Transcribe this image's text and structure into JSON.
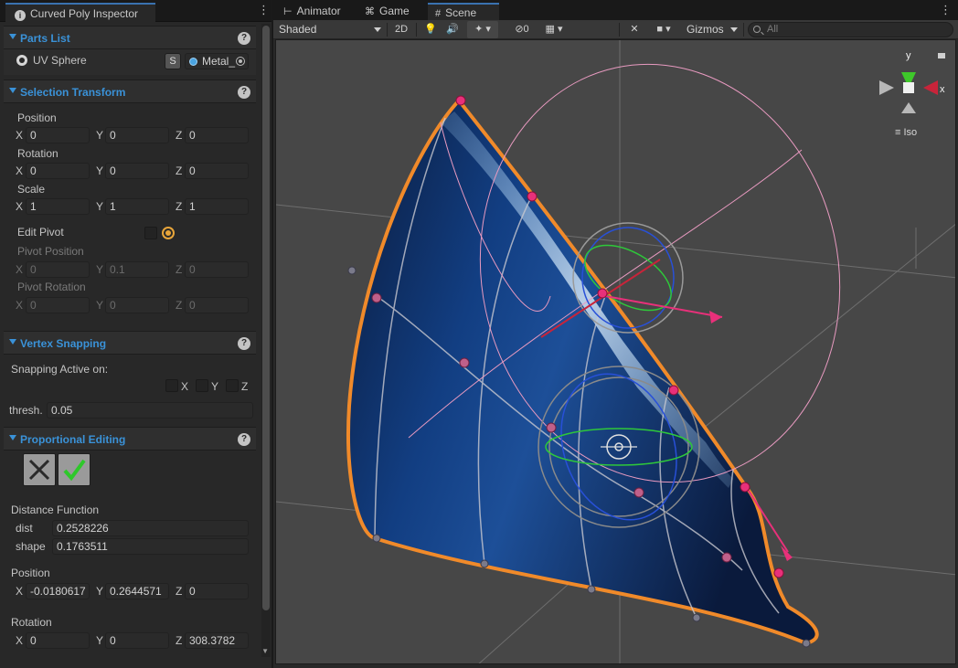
{
  "inspector": {
    "tab_title": "Curved Poly Inspector",
    "sections": {
      "parts_list": {
        "title": "Parts List"
      },
      "selection_transform": {
        "title": "Selection Transform"
      },
      "vertex_snapping": {
        "title": "Vertex Snapping"
      },
      "proportional_editing": {
        "title": "Proportional Editing"
      }
    },
    "parts": {
      "name": "UV Sphere",
      "s_label": "S",
      "material": "Metal_"
    },
    "transform": {
      "position_label": "Position",
      "position": {
        "x": "0",
        "y": "0",
        "z": "0"
      },
      "rotation_label": "Rotation",
      "rotation": {
        "x": "0",
        "y": "0",
        "z": "0"
      },
      "scale_label": "Scale",
      "scale": {
        "x": "1",
        "y": "1",
        "z": "1"
      },
      "edit_pivot_label": "Edit Pivot",
      "pivot_position_label": "Pivot Position",
      "pivot_position": {
        "x": "0",
        "y": "0.1",
        "z": "0"
      },
      "pivot_rotation_label": "Pivot Rotation",
      "pivot_rotation": {
        "x": "0",
        "y": "0",
        "z": "0"
      }
    },
    "axis_labels": {
      "x": "X",
      "y": "Y",
      "z": "Z"
    },
    "snapping": {
      "active_label": "Snapping Active on:",
      "thresh_label": "thresh.",
      "thresh": "0.05"
    },
    "proportional": {
      "distance_function_label": "Distance Function",
      "dist_label": "dist",
      "dist": "0.2528226",
      "shape_label": "shape",
      "shape": "0.1763511",
      "position_label": "Position",
      "position": {
        "x": "-0.0180617",
        "y": "0.2644571",
        "z": "0"
      },
      "rotation_label": "Rotation",
      "rotation": {
        "x": "0",
        "y": "0",
        "z": "308.3782"
      }
    }
  },
  "scene": {
    "tabs": [
      {
        "label": "Animator",
        "icon": "animator-icon"
      },
      {
        "label": "Game",
        "icon": "gamepad-icon"
      },
      {
        "label": "Scene",
        "icon": "grid-icon"
      }
    ],
    "draw_mode": "Shaded",
    "mode_2d": "2D",
    "hidden_count": "0",
    "gizmos_label": "Gizmos",
    "search_placeholder": "All",
    "orientation": {
      "y": "y",
      "x": "x",
      "projection": "Iso"
    }
  },
  "colors": {
    "accent": "#3a92d8",
    "selection_outline": "#f08a2a",
    "control_point": "#e8307a",
    "axis_x": "#c8243a",
    "axis_y": "#7ac843",
    "axis_z": "#3a7ad8"
  }
}
